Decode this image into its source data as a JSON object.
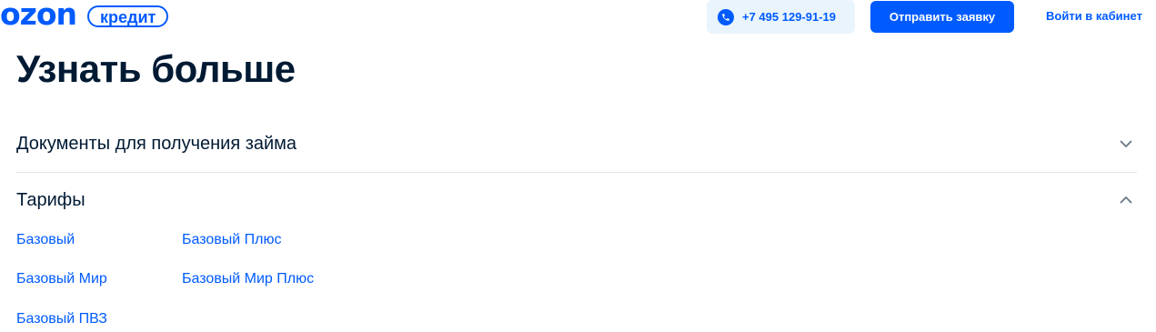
{
  "header": {
    "logo_text": "ozon",
    "logo_badge": "кредит",
    "phone": "+7 495 129-91-19",
    "apply_label": "Отправить заявку",
    "login_label": "Войти в кабинет"
  },
  "page_title": "Узнать больше",
  "accordion": [
    {
      "label": "Документы для получения займа",
      "state": "collapsed"
    },
    {
      "label": "Тарифы",
      "state": "expanded"
    }
  ],
  "tariffs": [
    "Базовый",
    "Базовый Плюс",
    "Базовый Мир",
    "Базовый Мир Плюс",
    "Базовый ПВЗ"
  ],
  "colors": {
    "brand": "#005bff",
    "text": "#001a34",
    "pill_bg": "#e9f4fd",
    "divider": "#e2e5ea"
  },
  "icons": {
    "phone": "phone-icon",
    "collapsed": "chevron-down-icon",
    "expanded": "chevron-up-icon"
  }
}
